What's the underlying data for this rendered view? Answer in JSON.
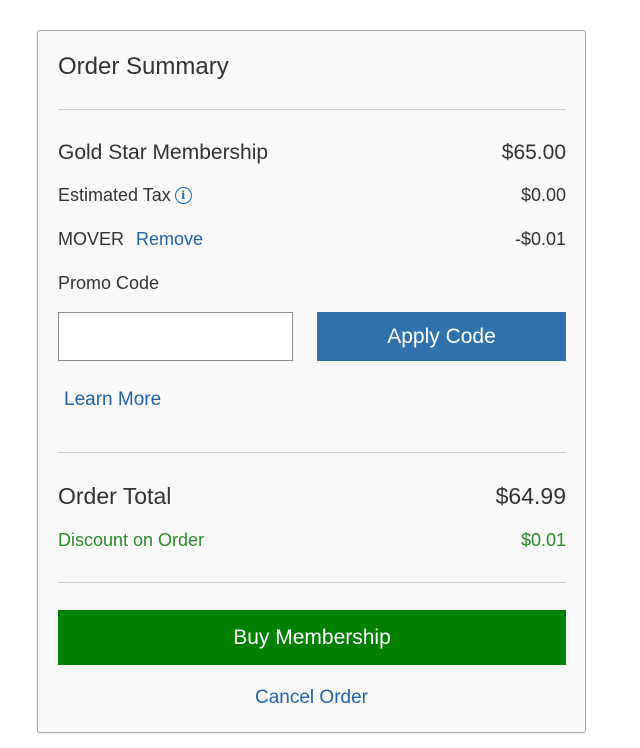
{
  "summary": {
    "title": "Order Summary",
    "membership": {
      "label": "Gold Star Membership",
      "amount": "$65.00"
    },
    "tax": {
      "label": "Estimated Tax",
      "info_icon": "info-icon",
      "info_glyph": "i",
      "amount": "$0.00"
    },
    "promo_applied": {
      "code": "MOVER",
      "remove_label": "Remove",
      "amount": "-$0.01"
    },
    "promo": {
      "label": "Promo Code",
      "input_value": "",
      "input_placeholder": "",
      "apply_label": "Apply Code",
      "learn_more": "Learn More"
    },
    "total": {
      "label": "Order Total",
      "amount": "$64.99"
    },
    "discount": {
      "label": "Discount on Order",
      "amount": "$0.01"
    },
    "buy_label": "Buy Membership",
    "cancel_label": "Cancel Order"
  },
  "colors": {
    "link": "#1f64a8",
    "apply_button": "#2f72ad",
    "buy_button": "#008000",
    "discount_text": "#2a8a2a",
    "card_background": "#f9f9f9"
  }
}
